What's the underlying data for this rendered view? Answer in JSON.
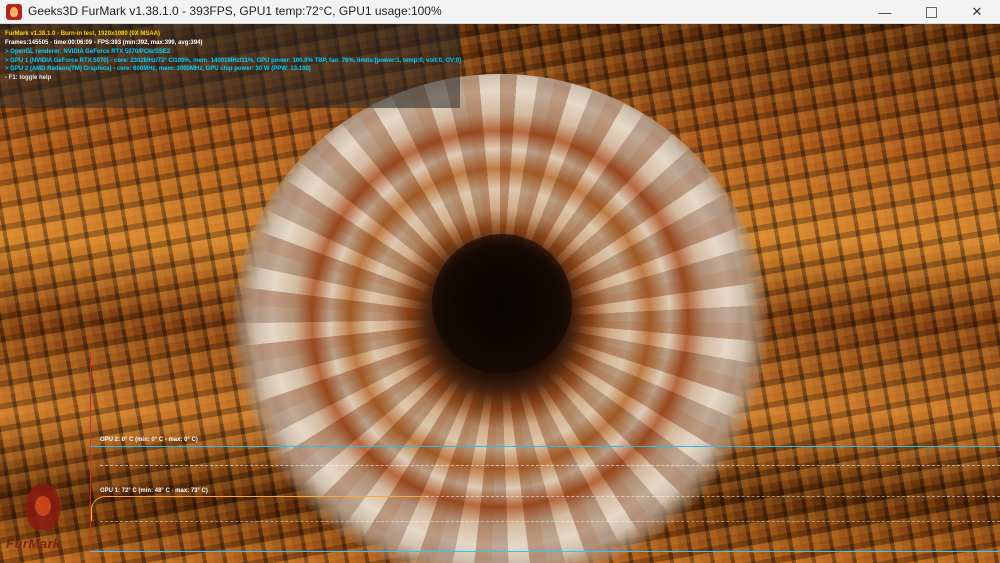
{
  "window": {
    "title": "Geeks3D FurMark v1.38.1.0 - 393FPS, GPU1 temp:72°C, GPU1 usage:100%",
    "icon": "furmark-app-icon",
    "controls": {
      "minimize_glyph": "—",
      "close_glyph": "✕"
    }
  },
  "osd": {
    "line1": "FurMark v1.38.1.0 - Burn-in test, 1920x1080 (0X MSAA)",
    "line2": "Frames:145505 - time:00:06:09 - FPS:393 (min:392, max:399, avg:394)",
    "line3": "> OpenGL renderer: NVIDIA GeForce RTX 5070/PCIe/SSE2",
    "line4": "> GPU 1 (NVIDIA GeForce RTX 5070) - core: 2302MHz/72° C/100%, mem: 14001MHz/11%, GPU power: 100.0% TBP, fan: 76%, limits:[power:1, temp:0, volt:0, OV:0]",
    "line5": "> GPU 2 (AMD Radeon(TM) Graphics) - core: 600MHz, mem: 3000MHz, GPU chip power: 30 W (PPW: 13.100)",
    "line6": "- F1: toggle help",
    "colors": {
      "title": "#ffd400",
      "stats": "#ffffff",
      "gpu": "#00d2ff",
      "help": "#e6e6e6"
    }
  },
  "graphs": {
    "gpu2_label": "GPU 2: 0° C (min: 0° C - max: 0° C)",
    "gpu1_label": "GPU 1: 72° C (min: 48° C - max: 73° C)",
    "gpu1_color": "#ffa63a",
    "gpu2_color": "#33b7e6",
    "axis_color": "#d62a2a"
  },
  "logo": {
    "text": "FurMark"
  }
}
